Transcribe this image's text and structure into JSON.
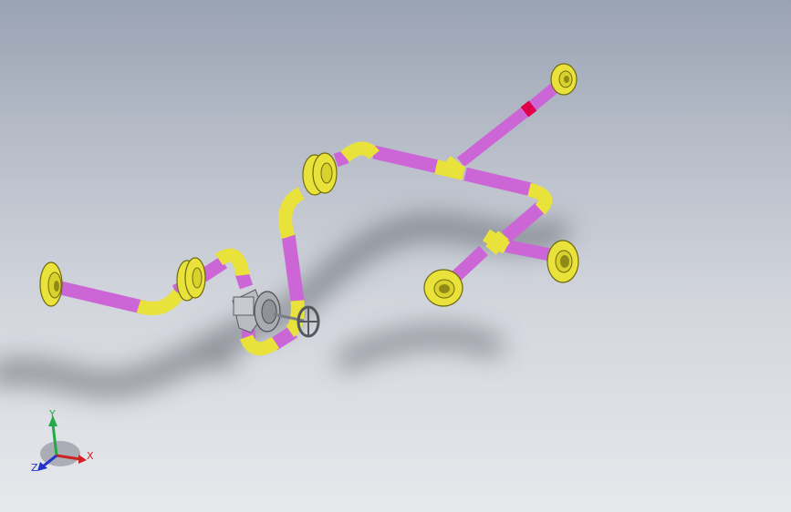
{
  "viewport": {
    "name": "graphics-area",
    "background_top": "#9aa3b4",
    "background_bottom": "#e7e8ec"
  },
  "model": {
    "pipe_color": "#cc66d6",
    "fitting_color": "#e8e23a",
    "valve_color": "#b9bcc2",
    "weld_color": "#e0004a"
  },
  "triad": {
    "x_label": "X",
    "y_label": "Y",
    "z_label": "Z",
    "x_color": "#cc2222",
    "y_color": "#22aa44",
    "z_color": "#2233cc"
  }
}
